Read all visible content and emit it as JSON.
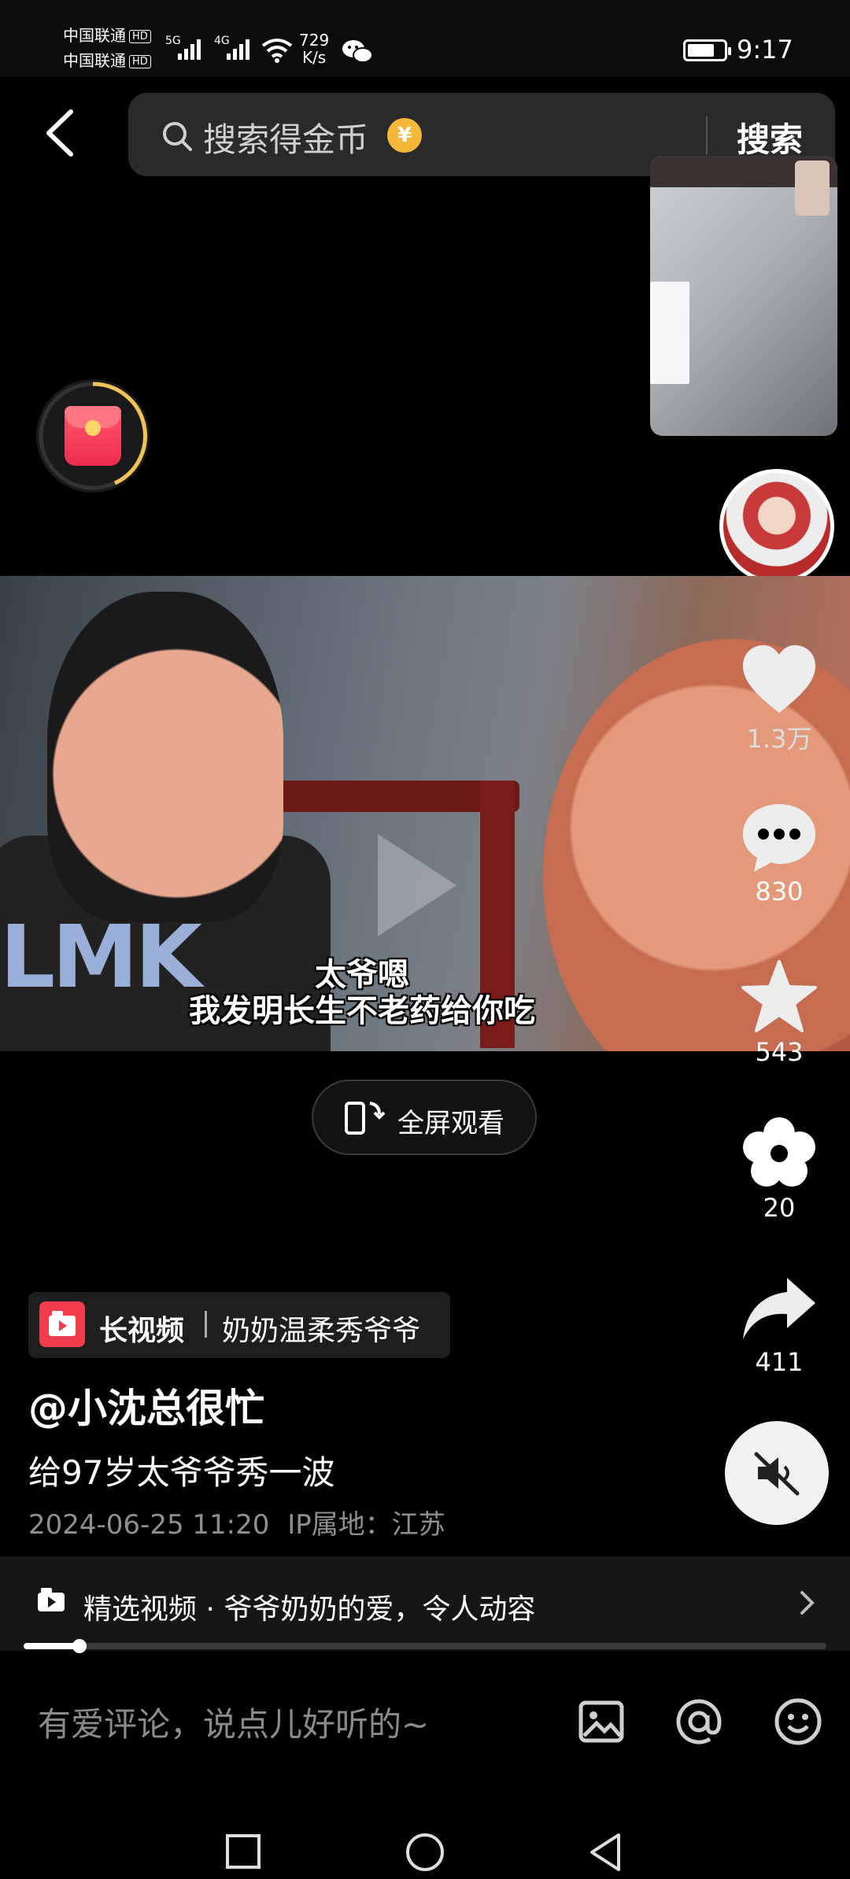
{
  "status_bar": {
    "carrier_1": "中国联通",
    "carrier_2": "中国联通",
    "hd": "HD",
    "network_1": "5G",
    "network_2": "4G",
    "net_speed_value": "729",
    "net_speed_unit": "K/s",
    "time": "9:17",
    "battery_level": 0.75
  },
  "search": {
    "placeholder": "搜索得金币",
    "coin_symbol": "¥",
    "button_label": "搜索"
  },
  "video": {
    "shirt_text": "LMK",
    "subtitle_line_1": "太爷嗯",
    "subtitle_line_2": "我发明长生不老药给你吃"
  },
  "fullscreen": {
    "label": "全屏观看"
  },
  "actions": {
    "like_count": "1.3万",
    "comment_count": "830",
    "favorite_count": "543",
    "flower_count": "20",
    "share_count": "411"
  },
  "info": {
    "tag_label": "长视频",
    "tag_title": "奶奶温柔秀爷爷",
    "author": "@小沈总很忙",
    "description": "给97岁太爷爷秀一波",
    "datetime": "2024-06-25 11:20",
    "ip_location": "IP属地：江苏"
  },
  "collection": {
    "text": "精选视频 · 爷爷奶奶的爱，令人动容"
  },
  "playback": {
    "progress": 0.07
  },
  "comment_bar": {
    "placeholder": "有爱评论，说点儿好听的~"
  },
  "icons": {
    "back": "back-arrow-icon",
    "search": "search-icon",
    "like": "heart-icon",
    "comment": "chat-bubble-icon",
    "favorite": "star-icon",
    "flower": "flower-icon",
    "share": "share-arrow-icon",
    "mute": "speaker-muted-icon",
    "image": "image-icon",
    "mention": "at-icon",
    "emoji": "emoji-icon"
  },
  "colors": {
    "accent_red": "#f23d4f",
    "coin_gold": "#f4b73a",
    "muted_text": "#8f8f8f"
  }
}
